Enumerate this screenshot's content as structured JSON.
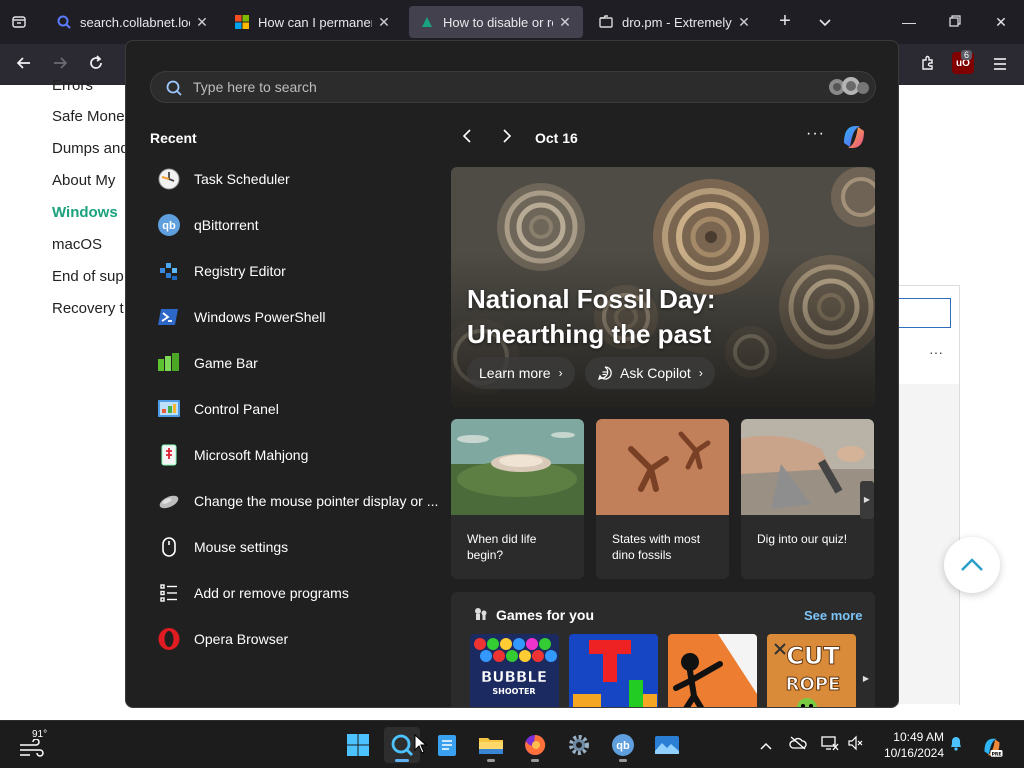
{
  "browser": {
    "tabs": [
      {
        "title": "search.collabnet.local/#",
        "favicon": "search-favicon",
        "active": false
      },
      {
        "title": "How can I permanently ena",
        "favicon": "microsoft-favicon",
        "active": false
      },
      {
        "title": "How to disable or remo",
        "favicon": "site-favicon",
        "active": true
      },
      {
        "title": "dro.pm - Extremely Sho",
        "favicon": "dropm-favicon",
        "active": false
      }
    ],
    "extension_badge_count": "6",
    "ublock_label": "uO"
  },
  "page": {
    "sidenav": [
      {
        "label": "Errors",
        "active": false
      },
      {
        "label": "Safe Mone",
        "active": false
      },
      {
        "label": "Dumps and",
        "active": false
      },
      {
        "label": "About My",
        "active": false
      },
      {
        "label": "Windows",
        "active": true
      },
      {
        "label": "macOS",
        "active": false
      },
      {
        "label": "End of sup",
        "active": false
      },
      {
        "label": "Recovery t",
        "active": false
      }
    ]
  },
  "search": {
    "placeholder": "Type here to search"
  },
  "recent": {
    "title": "Recent",
    "items": [
      {
        "label": "Task Scheduler",
        "icon": "task-scheduler-icon"
      },
      {
        "label": "qBittorrent",
        "icon": "qbittorrent-icon"
      },
      {
        "label": "Registry Editor",
        "icon": "registry-editor-icon"
      },
      {
        "label": "Windows PowerShell",
        "icon": "powershell-icon"
      },
      {
        "label": "Game Bar",
        "icon": "game-bar-icon"
      },
      {
        "label": "Control Panel",
        "icon": "control-panel-icon"
      },
      {
        "label": "Microsoft Mahjong",
        "icon": "mahjong-icon"
      },
      {
        "label": "Change the mouse pointer display or ...",
        "icon": "mouse-pointer-icon"
      },
      {
        "label": "Mouse settings",
        "icon": "mouse-icon"
      },
      {
        "label": "Add or remove programs",
        "icon": "programs-list-icon"
      },
      {
        "label": "Opera Browser",
        "icon": "opera-icon"
      }
    ]
  },
  "highlights": {
    "date": "Oct 16",
    "hero": {
      "title": "National Fossil Day: Unearthing the past",
      "learn_more": "Learn more",
      "ask_copilot": "Ask Copilot"
    },
    "cards": [
      {
        "text": "When did life begin?"
      },
      {
        "text": "States with most dino fossils"
      },
      {
        "text": "Dig into our quiz!"
      }
    ],
    "games": {
      "title": "Games for you",
      "see_more": "See more",
      "tiles": [
        "Bubble Shooter",
        "Block puzzle",
        "Stickman fighter",
        "Cut the Rope"
      ],
      "bubble_label_1": "BUBBLE",
      "bubble_label_2": "SHOOTER",
      "cut_label_1": "CUT",
      "cut_label_2": "ROPE"
    }
  },
  "taskbar": {
    "weather_temp": "91°",
    "time": "10:49 AM",
    "date": "10/16/2024"
  },
  "colors": {
    "accent_green": "#1aa17e",
    "flyout_bg": "#202020",
    "see_more": "#7cc4f8"
  }
}
